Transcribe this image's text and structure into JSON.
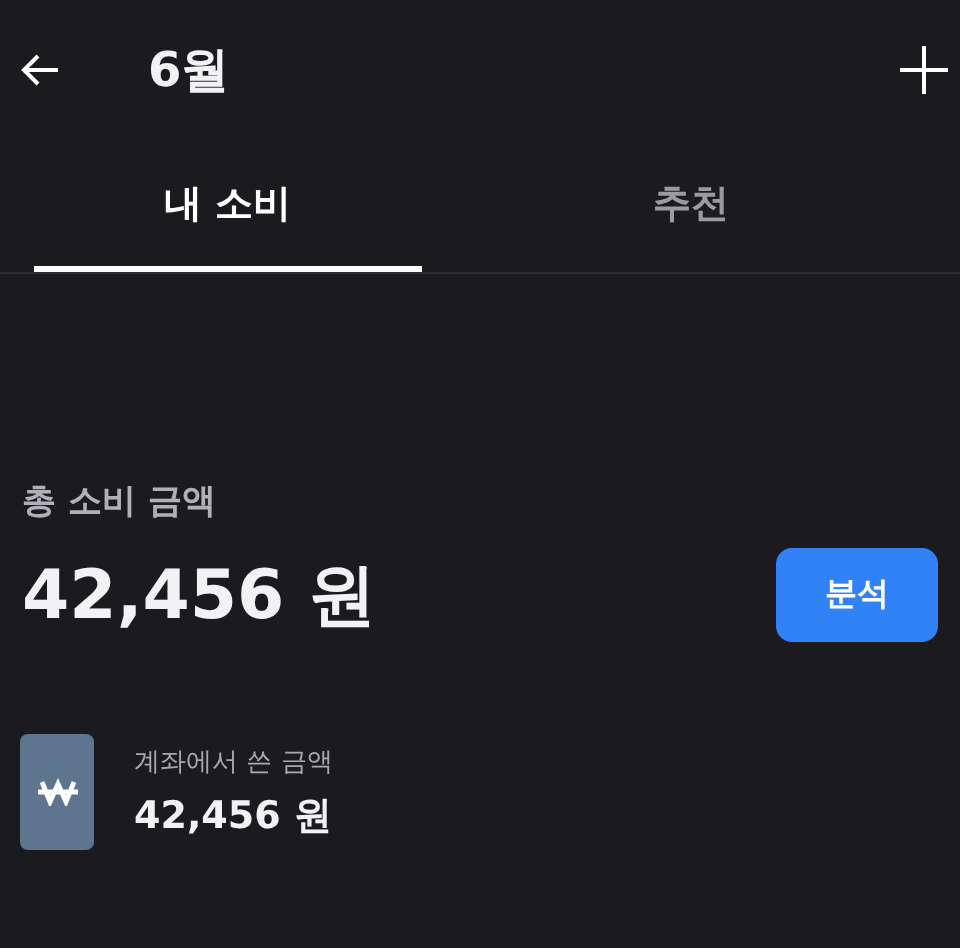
{
  "header": {
    "title": "6월"
  },
  "tabs": [
    {
      "label": "내 소비",
      "selected": true
    },
    {
      "label": "추천",
      "selected": false
    }
  ],
  "summary": {
    "label": "총 소비 금액",
    "amount": "42,456 원",
    "button": "분석"
  },
  "sources": [
    {
      "label": "계좌에서 쓴 금액",
      "amount": "42,456 원"
    }
  ]
}
